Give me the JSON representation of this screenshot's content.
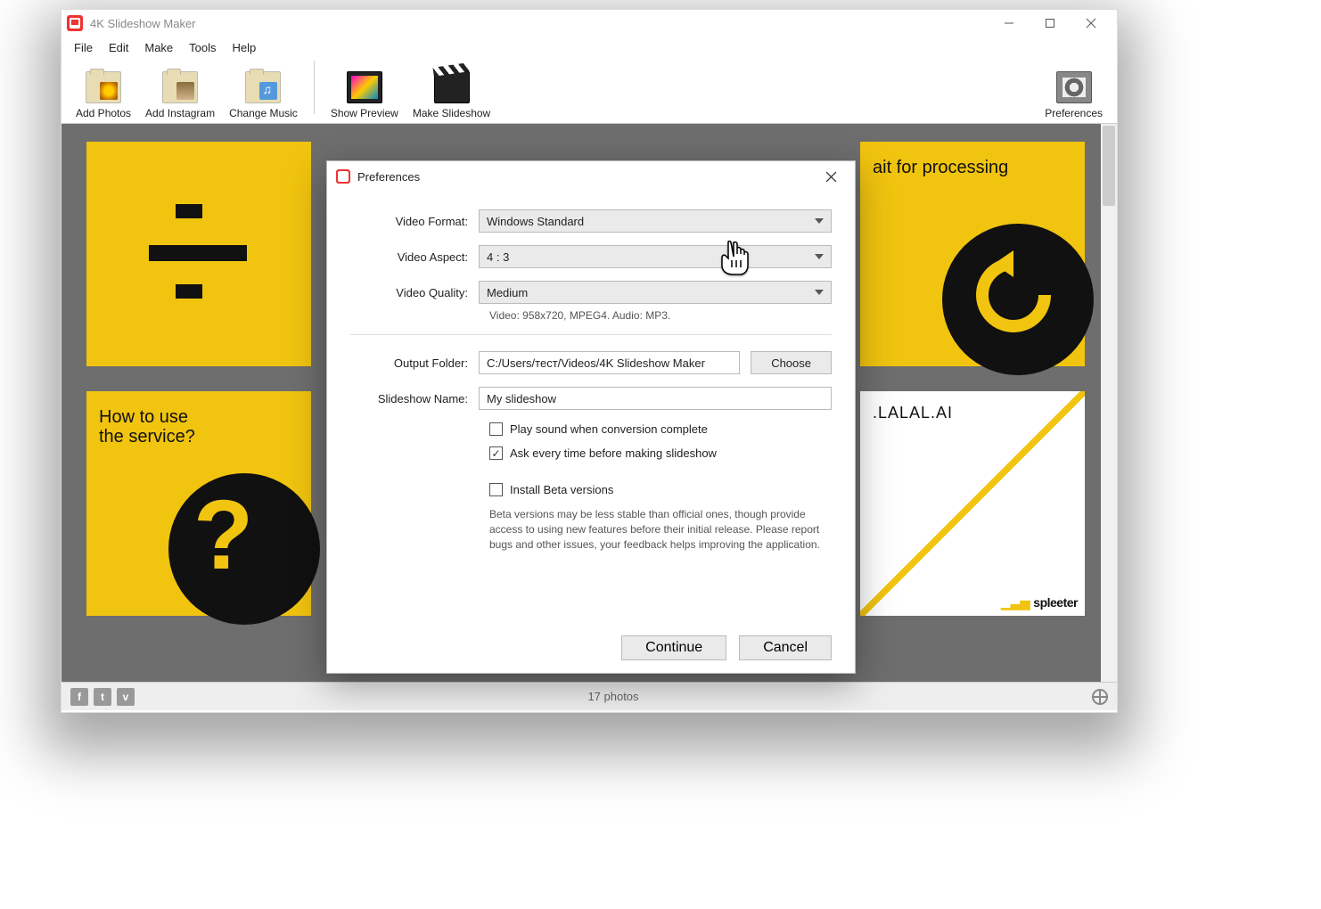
{
  "window": {
    "title": "4K Slideshow Maker",
    "menu": [
      "File",
      "Edit",
      "Make",
      "Tools",
      "Help"
    ]
  },
  "toolbar": {
    "add_photos": "Add Photos",
    "add_instagram": "Add Instagram",
    "change_music": "Change Music",
    "show_preview": "Show Preview",
    "make_slideshow": "Make Slideshow",
    "preferences": "Preferences"
  },
  "thumbs": {
    "t2_label": "How to use\nthe service?",
    "t5_label": "ait for processing",
    "t6_lal": ".LALAL.AI",
    "t6_brand": "spleeter"
  },
  "status": {
    "count": "17 photos"
  },
  "dialog": {
    "title": "Preferences",
    "labels": {
      "video_format": "Video Format:",
      "video_aspect": "Video Aspect:",
      "video_quality": "Video Quality:",
      "output_folder": "Output Folder:",
      "slideshow_name": "Slideshow Name:"
    },
    "values": {
      "video_format": "Windows Standard",
      "video_aspect": "4 : 3",
      "video_quality": "Medium",
      "quality_info": "Video: 958x720, MPEG4. Audio: MP3.",
      "output_folder": "C:/Users/тест/Videos/4K Slideshow Maker",
      "slideshow_name": "My slideshow"
    },
    "buttons": {
      "choose": "Choose",
      "continue": "Continue",
      "cancel": "Cancel"
    },
    "checks": {
      "play_sound": "Play sound when conversion complete",
      "ask_every": "Ask every time before making slideshow",
      "install_beta": "Install Beta versions"
    },
    "beta_note": "Beta versions may be less stable than official ones, though provide access to using new features before their initial release. Please report bugs and other issues, your feedback helps improving the application."
  }
}
